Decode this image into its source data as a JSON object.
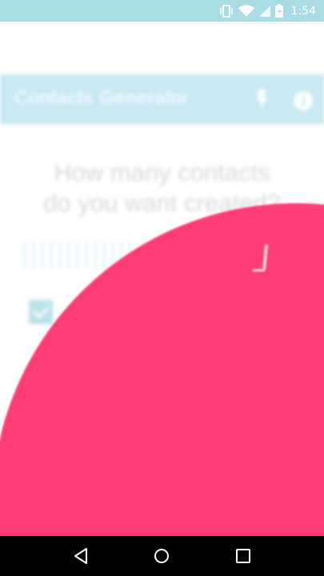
{
  "status_bar": {
    "time": "1:54",
    "icons": [
      "vibrate-icon",
      "wifi-icon",
      "signal-icon",
      "battery-icon"
    ]
  },
  "app_bar": {
    "title": "Contacts Generator",
    "actions": [
      "flash-icon",
      "info-icon"
    ]
  },
  "main": {
    "question_line1": "How many contacts",
    "question_line2": "do you want created?",
    "checkbox_checked": true
  },
  "overlay": {
    "color": "#ff3d75"
  },
  "nav_bar": {
    "buttons": [
      "back-icon",
      "home-icon",
      "recents-icon"
    ]
  },
  "colors": {
    "status_bar": "#a9dde3",
    "app_bar": "#c8eaf0",
    "accent": "#ff3d75"
  }
}
